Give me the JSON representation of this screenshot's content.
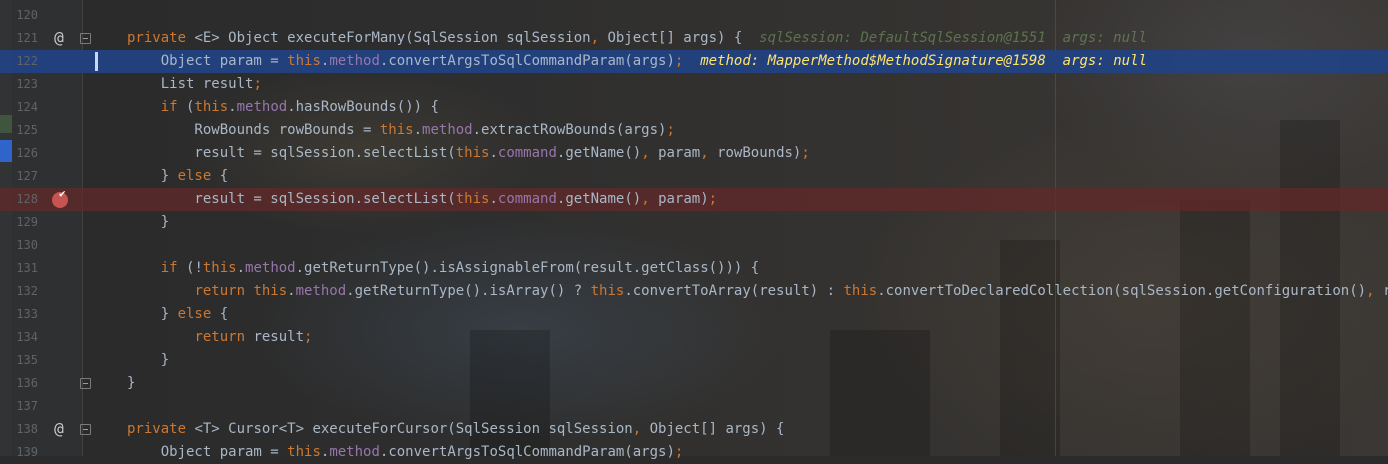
{
  "theme": {
    "background": "#2b2b2b",
    "keyword": "#cc7832",
    "default_text": "#a9b7c6",
    "field": "#9876aa",
    "execution_highlight": "#214283",
    "breakpoint_highlight": "#643232",
    "inline_value": "#ffe36e",
    "line_number": "#606366"
  },
  "gutter_icons": {
    "line_121": "override-at-icon",
    "line_128": "breakpoint-verified-icon",
    "line_138": "override-at-icon"
  },
  "lines": [
    {
      "num": "120",
      "parts": []
    },
    {
      "num": "121",
      "parts": [
        {
          "t": "private ",
          "c": "kw"
        },
        {
          "t": "<E> Object executeForMany(SqlSession sqlSession",
          "c": "tp"
        },
        {
          "t": ", ",
          "c": "punc"
        },
        {
          "t": "Object[] args) {  ",
          "c": "tp"
        },
        {
          "t": "sqlSession: DefaultSqlSession@1551  args: null",
          "c": "hint-dim"
        }
      ]
    },
    {
      "num": "122",
      "parts": [
        {
          "t": "    Object param = ",
          "c": "tp"
        },
        {
          "t": "this",
          "c": "kw"
        },
        {
          "t": ".",
          "c": "tp"
        },
        {
          "t": "method",
          "c": "fld"
        },
        {
          "t": ".convertArgsToSqlCommandParam(args)",
          "c": "tp"
        },
        {
          "t": ";  ",
          "c": "punc"
        },
        {
          "t": "method: MapperMethod$MethodSignature@1598  args: null",
          "c": "hint-bright"
        }
      ]
    },
    {
      "num": "123",
      "parts": [
        {
          "t": "    List result",
          "c": "tp"
        },
        {
          "t": ";",
          "c": "punc"
        }
      ]
    },
    {
      "num": "124",
      "parts": [
        {
          "t": "    ",
          "c": "tp"
        },
        {
          "t": "if ",
          "c": "kw"
        },
        {
          "t": "(",
          "c": "tp"
        },
        {
          "t": "this",
          "c": "kw"
        },
        {
          "t": ".",
          "c": "tp"
        },
        {
          "t": "method",
          "c": "fld"
        },
        {
          "t": ".hasRowBounds()) {",
          "c": "tp"
        }
      ]
    },
    {
      "num": "125",
      "parts": [
        {
          "t": "        RowBounds rowBounds = ",
          "c": "tp"
        },
        {
          "t": "this",
          "c": "kw"
        },
        {
          "t": ".",
          "c": "tp"
        },
        {
          "t": "method",
          "c": "fld"
        },
        {
          "t": ".extractRowBounds(args)",
          "c": "tp"
        },
        {
          "t": ";",
          "c": "punc"
        }
      ]
    },
    {
      "num": "126",
      "parts": [
        {
          "t": "        result = sqlSession.selectList(",
          "c": "tp"
        },
        {
          "t": "this",
          "c": "kw"
        },
        {
          "t": ".",
          "c": "tp"
        },
        {
          "t": "command",
          "c": "fld"
        },
        {
          "t": ".getName()",
          "c": "tp"
        },
        {
          "t": ", ",
          "c": "punc"
        },
        {
          "t": "param",
          "c": "tp"
        },
        {
          "t": ", ",
          "c": "punc"
        },
        {
          "t": "rowBounds)",
          "c": "tp"
        },
        {
          "t": ";",
          "c": "punc"
        }
      ]
    },
    {
      "num": "127",
      "parts": [
        {
          "t": "    } ",
          "c": "tp"
        },
        {
          "t": "else ",
          "c": "kw"
        },
        {
          "t": "{",
          "c": "tp"
        }
      ]
    },
    {
      "num": "128",
      "parts": [
        {
          "t": "        result = sqlSession.selectList(",
          "c": "tp"
        },
        {
          "t": "this",
          "c": "kw"
        },
        {
          "t": ".",
          "c": "tp"
        },
        {
          "t": "command",
          "c": "fld"
        },
        {
          "t": ".getName()",
          "c": "tp"
        },
        {
          "t": ", ",
          "c": "punc"
        },
        {
          "t": "param)",
          "c": "tp"
        },
        {
          "t": ";",
          "c": "punc"
        }
      ]
    },
    {
      "num": "129",
      "parts": [
        {
          "t": "    }",
          "c": "tp"
        }
      ]
    },
    {
      "num": "130",
      "parts": []
    },
    {
      "num": "131",
      "parts": [
        {
          "t": "    ",
          "c": "tp"
        },
        {
          "t": "if ",
          "c": "kw"
        },
        {
          "t": "(!",
          "c": "tp"
        },
        {
          "t": "this",
          "c": "kw"
        },
        {
          "t": ".",
          "c": "tp"
        },
        {
          "t": "method",
          "c": "fld"
        },
        {
          "t": ".getReturnType().isAssignableFrom(result.getClass())) {",
          "c": "tp"
        }
      ]
    },
    {
      "num": "132",
      "parts": [
        {
          "t": "        ",
          "c": "tp"
        },
        {
          "t": "return this",
          "c": "kw"
        },
        {
          "t": ".",
          "c": "tp"
        },
        {
          "t": "method",
          "c": "fld"
        },
        {
          "t": ".getReturnType().isArray() ? ",
          "c": "tp"
        },
        {
          "t": "this",
          "c": "kw"
        },
        {
          "t": ".convertToArray(result) : ",
          "c": "tp"
        },
        {
          "t": "this",
          "c": "kw"
        },
        {
          "t": ".convertToDeclaredCollection(sqlSession.getConfiguration()",
          "c": "tp"
        },
        {
          "t": ", ",
          "c": "punc"
        },
        {
          "t": "result)",
          "c": "tp"
        },
        {
          "t": ";",
          "c": "punc"
        }
      ]
    },
    {
      "num": "133",
      "parts": [
        {
          "t": "    } ",
          "c": "tp"
        },
        {
          "t": "else ",
          "c": "kw"
        },
        {
          "t": "{",
          "c": "tp"
        }
      ]
    },
    {
      "num": "134",
      "parts": [
        {
          "t": "        ",
          "c": "tp"
        },
        {
          "t": "return ",
          "c": "kw"
        },
        {
          "t": "result",
          "c": "tp"
        },
        {
          "t": ";",
          "c": "punc"
        }
      ]
    },
    {
      "num": "135",
      "parts": [
        {
          "t": "    }",
          "c": "tp"
        }
      ]
    },
    {
      "num": "136",
      "parts": [
        {
          "t": "}",
          "c": "tp"
        }
      ]
    },
    {
      "num": "137",
      "parts": []
    },
    {
      "num": "138",
      "parts": [
        {
          "t": "private ",
          "c": "kw"
        },
        {
          "t": "<T> Cursor<T> executeForCursor(SqlSession sqlSession",
          "c": "tp"
        },
        {
          "t": ", ",
          "c": "punc"
        },
        {
          "t": "Object[] args) {",
          "c": "tp"
        }
      ]
    },
    {
      "num": "139",
      "parts": [
        {
          "t": "    Object param = ",
          "c": "tp"
        },
        {
          "t": "this",
          "c": "kw"
        },
        {
          "t": ".",
          "c": "tp"
        },
        {
          "t": "method",
          "c": "fld"
        },
        {
          "t": ".convertArgsToSqlCommandParam(args)",
          "c": "tp"
        },
        {
          "t": ";",
          "c": "punc"
        }
      ]
    }
  ]
}
